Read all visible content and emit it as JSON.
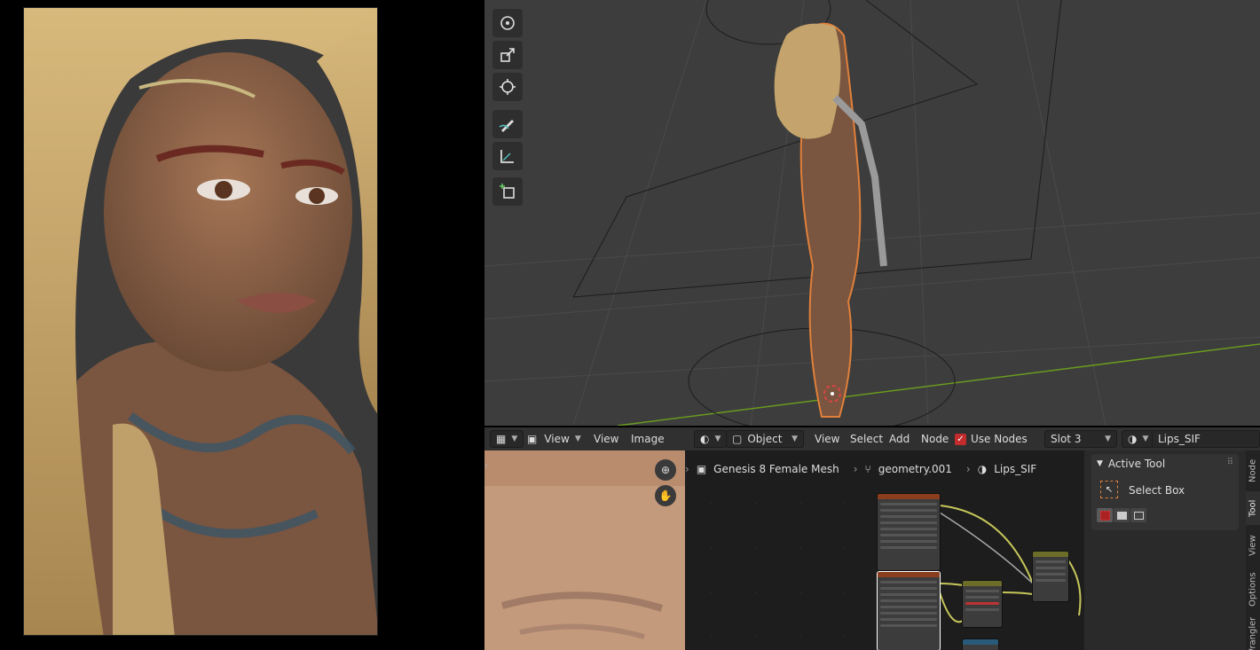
{
  "image_header": {
    "editor_type_icon": "image-editor-icon",
    "image_icon": "image-icon",
    "view_menu_1": "View",
    "view_menu_2": "View",
    "image_menu": "Image"
  },
  "node_header": {
    "shading_icon": "sphere-icon",
    "mode_select": "Object",
    "view_menu": "View",
    "select_menu": "Select",
    "add_menu": "Add",
    "node_menu": "Node",
    "use_nodes_label": "Use Nodes",
    "use_nodes_checked": true,
    "slot_select": "Slot 3",
    "material_name": "Lips_SIF"
  },
  "breadcrumbs": {
    "object": "Genesis 8 Female Mesh",
    "mesh": "geometry.001",
    "material": "Lips_SIF"
  },
  "sidebar": {
    "panel_title": "Active Tool",
    "tool_name": "Select Box",
    "tabs": [
      "Node",
      "Tool",
      "View",
      "Options",
      "Wrangler"
    ],
    "active_tab": "Tool"
  },
  "toolbar_icons": [
    "rotate-icon",
    "scale-icon",
    "transform-icon",
    "annotate-icon",
    "measure-icon",
    "add-cube-icon"
  ],
  "colors": {
    "accent": "#e0803a",
    "checkbox": "#c22c2c",
    "grid_x_axis": "#6a9a1f"
  }
}
